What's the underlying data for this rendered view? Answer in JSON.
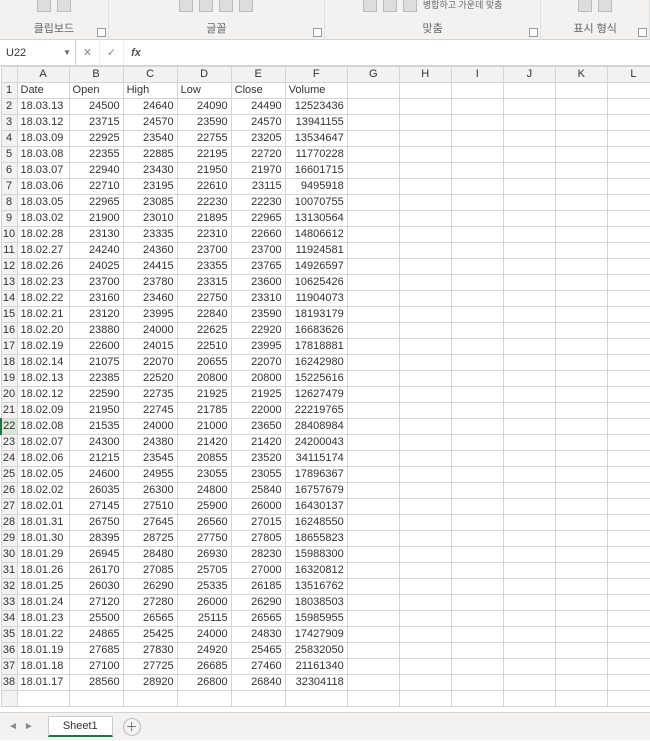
{
  "ribbon": {
    "groups": [
      "클립보드",
      "글꼴",
      "맞춤",
      "표시 형식"
    ],
    "merge_center_text": "병합하고 가운데 맞춤"
  },
  "namebox": {
    "value": "U22"
  },
  "columns": [
    "A",
    "B",
    "C",
    "D",
    "E",
    "F",
    "G",
    "H",
    "I",
    "J",
    "K",
    "L"
  ],
  "headers": {
    "A": "Date",
    "B": "Open",
    "C": "High",
    "D": "Low",
    "E": "Close",
    "F": "Volume"
  },
  "selected_row": 22,
  "rows": [
    {
      "r": 2,
      "A": "18.03.13",
      "B": 24500,
      "C": 24640,
      "D": 24090,
      "E": 24490,
      "F": 12523436
    },
    {
      "r": 3,
      "A": "18.03.12",
      "B": 23715,
      "C": 24570,
      "D": 23590,
      "E": 24570,
      "F": 13941155
    },
    {
      "r": 4,
      "A": "18.03.09",
      "B": 22925,
      "C": 23540,
      "D": 22755,
      "E": 23205,
      "F": 13534647
    },
    {
      "r": 5,
      "A": "18.03.08",
      "B": 22355,
      "C": 22885,
      "D": 22195,
      "E": 22720,
      "F": 11770228
    },
    {
      "r": 6,
      "A": "18.03.07",
      "B": 22940,
      "C": 23430,
      "D": 21950,
      "E": 21970,
      "F": 16601715
    },
    {
      "r": 7,
      "A": "18.03.06",
      "B": 22710,
      "C": 23195,
      "D": 22610,
      "E": 23115,
      "F": 9495918
    },
    {
      "r": 8,
      "A": "18.03.05",
      "B": 22965,
      "C": 23085,
      "D": 22230,
      "E": 22230,
      "F": 10070755
    },
    {
      "r": 9,
      "A": "18.03.02",
      "B": 21900,
      "C": 23010,
      "D": 21895,
      "E": 22965,
      "F": 13130564
    },
    {
      "r": 10,
      "A": "18.02.28",
      "B": 23130,
      "C": 23335,
      "D": 22310,
      "E": 22660,
      "F": 14806612
    },
    {
      "r": 11,
      "A": "18.02.27",
      "B": 24240,
      "C": 24360,
      "D": 23700,
      "E": 23700,
      "F": 11924581
    },
    {
      "r": 12,
      "A": "18.02.26",
      "B": 24025,
      "C": 24415,
      "D": 23355,
      "E": 23765,
      "F": 14926597
    },
    {
      "r": 13,
      "A": "18.02.23",
      "B": 23700,
      "C": 23780,
      "D": 23315,
      "E": 23600,
      "F": 10625426
    },
    {
      "r": 14,
      "A": "18.02.22",
      "B": 23160,
      "C": 23460,
      "D": 22750,
      "E": 23310,
      "F": 11904073
    },
    {
      "r": 15,
      "A": "18.02.21",
      "B": 23120,
      "C": 23995,
      "D": 22840,
      "E": 23590,
      "F": 18193179
    },
    {
      "r": 16,
      "A": "18.02.20",
      "B": 23880,
      "C": 24000,
      "D": 22625,
      "E": 22920,
      "F": 16683626
    },
    {
      "r": 17,
      "A": "18.02.19",
      "B": 22600,
      "C": 24015,
      "D": 22510,
      "E": 23995,
      "F": 17818881
    },
    {
      "r": 18,
      "A": "18.02.14",
      "B": 21075,
      "C": 22070,
      "D": 20655,
      "E": 22070,
      "F": 16242980
    },
    {
      "r": 19,
      "A": "18.02.13",
      "B": 22385,
      "C": 22520,
      "D": 20800,
      "E": 20800,
      "F": 15225616
    },
    {
      "r": 20,
      "A": "18.02.12",
      "B": 22590,
      "C": 22735,
      "D": 21925,
      "E": 21925,
      "F": 12627479
    },
    {
      "r": 21,
      "A": "18.02.09",
      "B": 21950,
      "C": 22745,
      "D": 21785,
      "E": 22000,
      "F": 22219765
    },
    {
      "r": 22,
      "A": "18.02.08",
      "B": 21535,
      "C": 24000,
      "D": 21000,
      "E": 23650,
      "F": 28408984
    },
    {
      "r": 23,
      "A": "18.02.07",
      "B": 24300,
      "C": 24380,
      "D": 21420,
      "E": 21420,
      "F": 24200043
    },
    {
      "r": 24,
      "A": "18.02.06",
      "B": 21215,
      "C": 23545,
      "D": 20855,
      "E": 23520,
      "F": 34115174
    },
    {
      "r": 25,
      "A": "18.02.05",
      "B": 24600,
      "C": 24955,
      "D": 23055,
      "E": 23055,
      "F": 17896367
    },
    {
      "r": 26,
      "A": "18.02.02",
      "B": 26035,
      "C": 26300,
      "D": 24800,
      "E": 25840,
      "F": 16757679
    },
    {
      "r": 27,
      "A": "18.02.01",
      "B": 27145,
      "C": 27510,
      "D": 25900,
      "E": 26000,
      "F": 16430137
    },
    {
      "r": 28,
      "A": "18.01.31",
      "B": 26750,
      "C": 27645,
      "D": 26560,
      "E": 27015,
      "F": 16248550
    },
    {
      "r": 29,
      "A": "18.01.30",
      "B": 28395,
      "C": 28725,
      "D": 27750,
      "E": 27805,
      "F": 18655823
    },
    {
      "r": 30,
      "A": "18.01.29",
      "B": 26945,
      "C": 28480,
      "D": 26930,
      "E": 28230,
      "F": 15988300
    },
    {
      "r": 31,
      "A": "18.01.26",
      "B": 26170,
      "C": 27085,
      "D": 25705,
      "E": 27000,
      "F": 16320812
    },
    {
      "r": 32,
      "A": "18.01.25",
      "B": 26030,
      "C": 26290,
      "D": 25335,
      "E": 26185,
      "F": 13516762
    },
    {
      "r": 33,
      "A": "18.01.24",
      "B": 27120,
      "C": 27280,
      "D": 26000,
      "E": 26290,
      "F": 18038503
    },
    {
      "r": 34,
      "A": "18.01.23",
      "B": 25500,
      "C": 26565,
      "D": 25115,
      "E": 26565,
      "F": 15985955
    },
    {
      "r": 35,
      "A": "18.01.22",
      "B": 24865,
      "C": 25425,
      "D": 24000,
      "E": 24830,
      "F": 17427909
    },
    {
      "r": 36,
      "A": "18.01.19",
      "B": 27685,
      "C": 27830,
      "D": 24920,
      "E": 25465,
      "F": 25832050
    },
    {
      "r": 37,
      "A": "18.01.18",
      "B": 27100,
      "C": 27725,
      "D": 26685,
      "E": 27460,
      "F": 21161340
    },
    {
      "r": 38,
      "A": "18.01.17",
      "B": 28560,
      "C": 28920,
      "D": 26800,
      "E": 26840,
      "F": 32304118
    }
  ],
  "sheet_tab": "Sheet1"
}
